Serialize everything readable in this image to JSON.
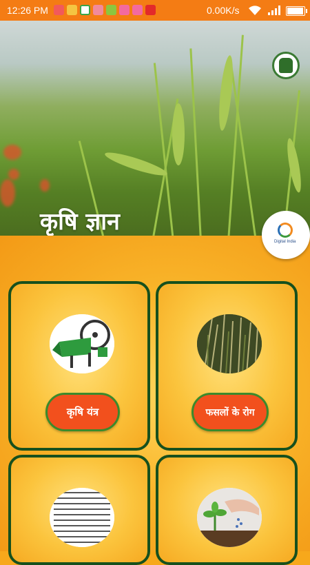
{
  "status_bar": {
    "time": "12:26 PM",
    "network_speed": "0.00K/s",
    "notification_icons": [
      "notification-icon",
      "message-icon",
      "app-icon",
      "notification-icon",
      "android-icon",
      "calendar-icon",
      "calendar-icon",
      "app-icon"
    ],
    "battery_level": 0.9
  },
  "banner": {
    "title": "कृषि ज्ञान",
    "emblem_icon": "emblem-logo-icon",
    "digital_india_logo": "Digital India"
  },
  "tiles": [
    {
      "label": "कृषि यंत्र",
      "image": "farm-machine-image"
    },
    {
      "label": "फसलों के रोग",
      "image": "crop-disease-image"
    },
    {
      "label": "",
      "image": "calendar-image"
    },
    {
      "label": "",
      "image": "seedling-image"
    }
  ],
  "colors": {
    "status_bar": "#f47c14",
    "card_border": "#17501d",
    "button": "#f2501d",
    "button_border": "#3b8a2c"
  }
}
